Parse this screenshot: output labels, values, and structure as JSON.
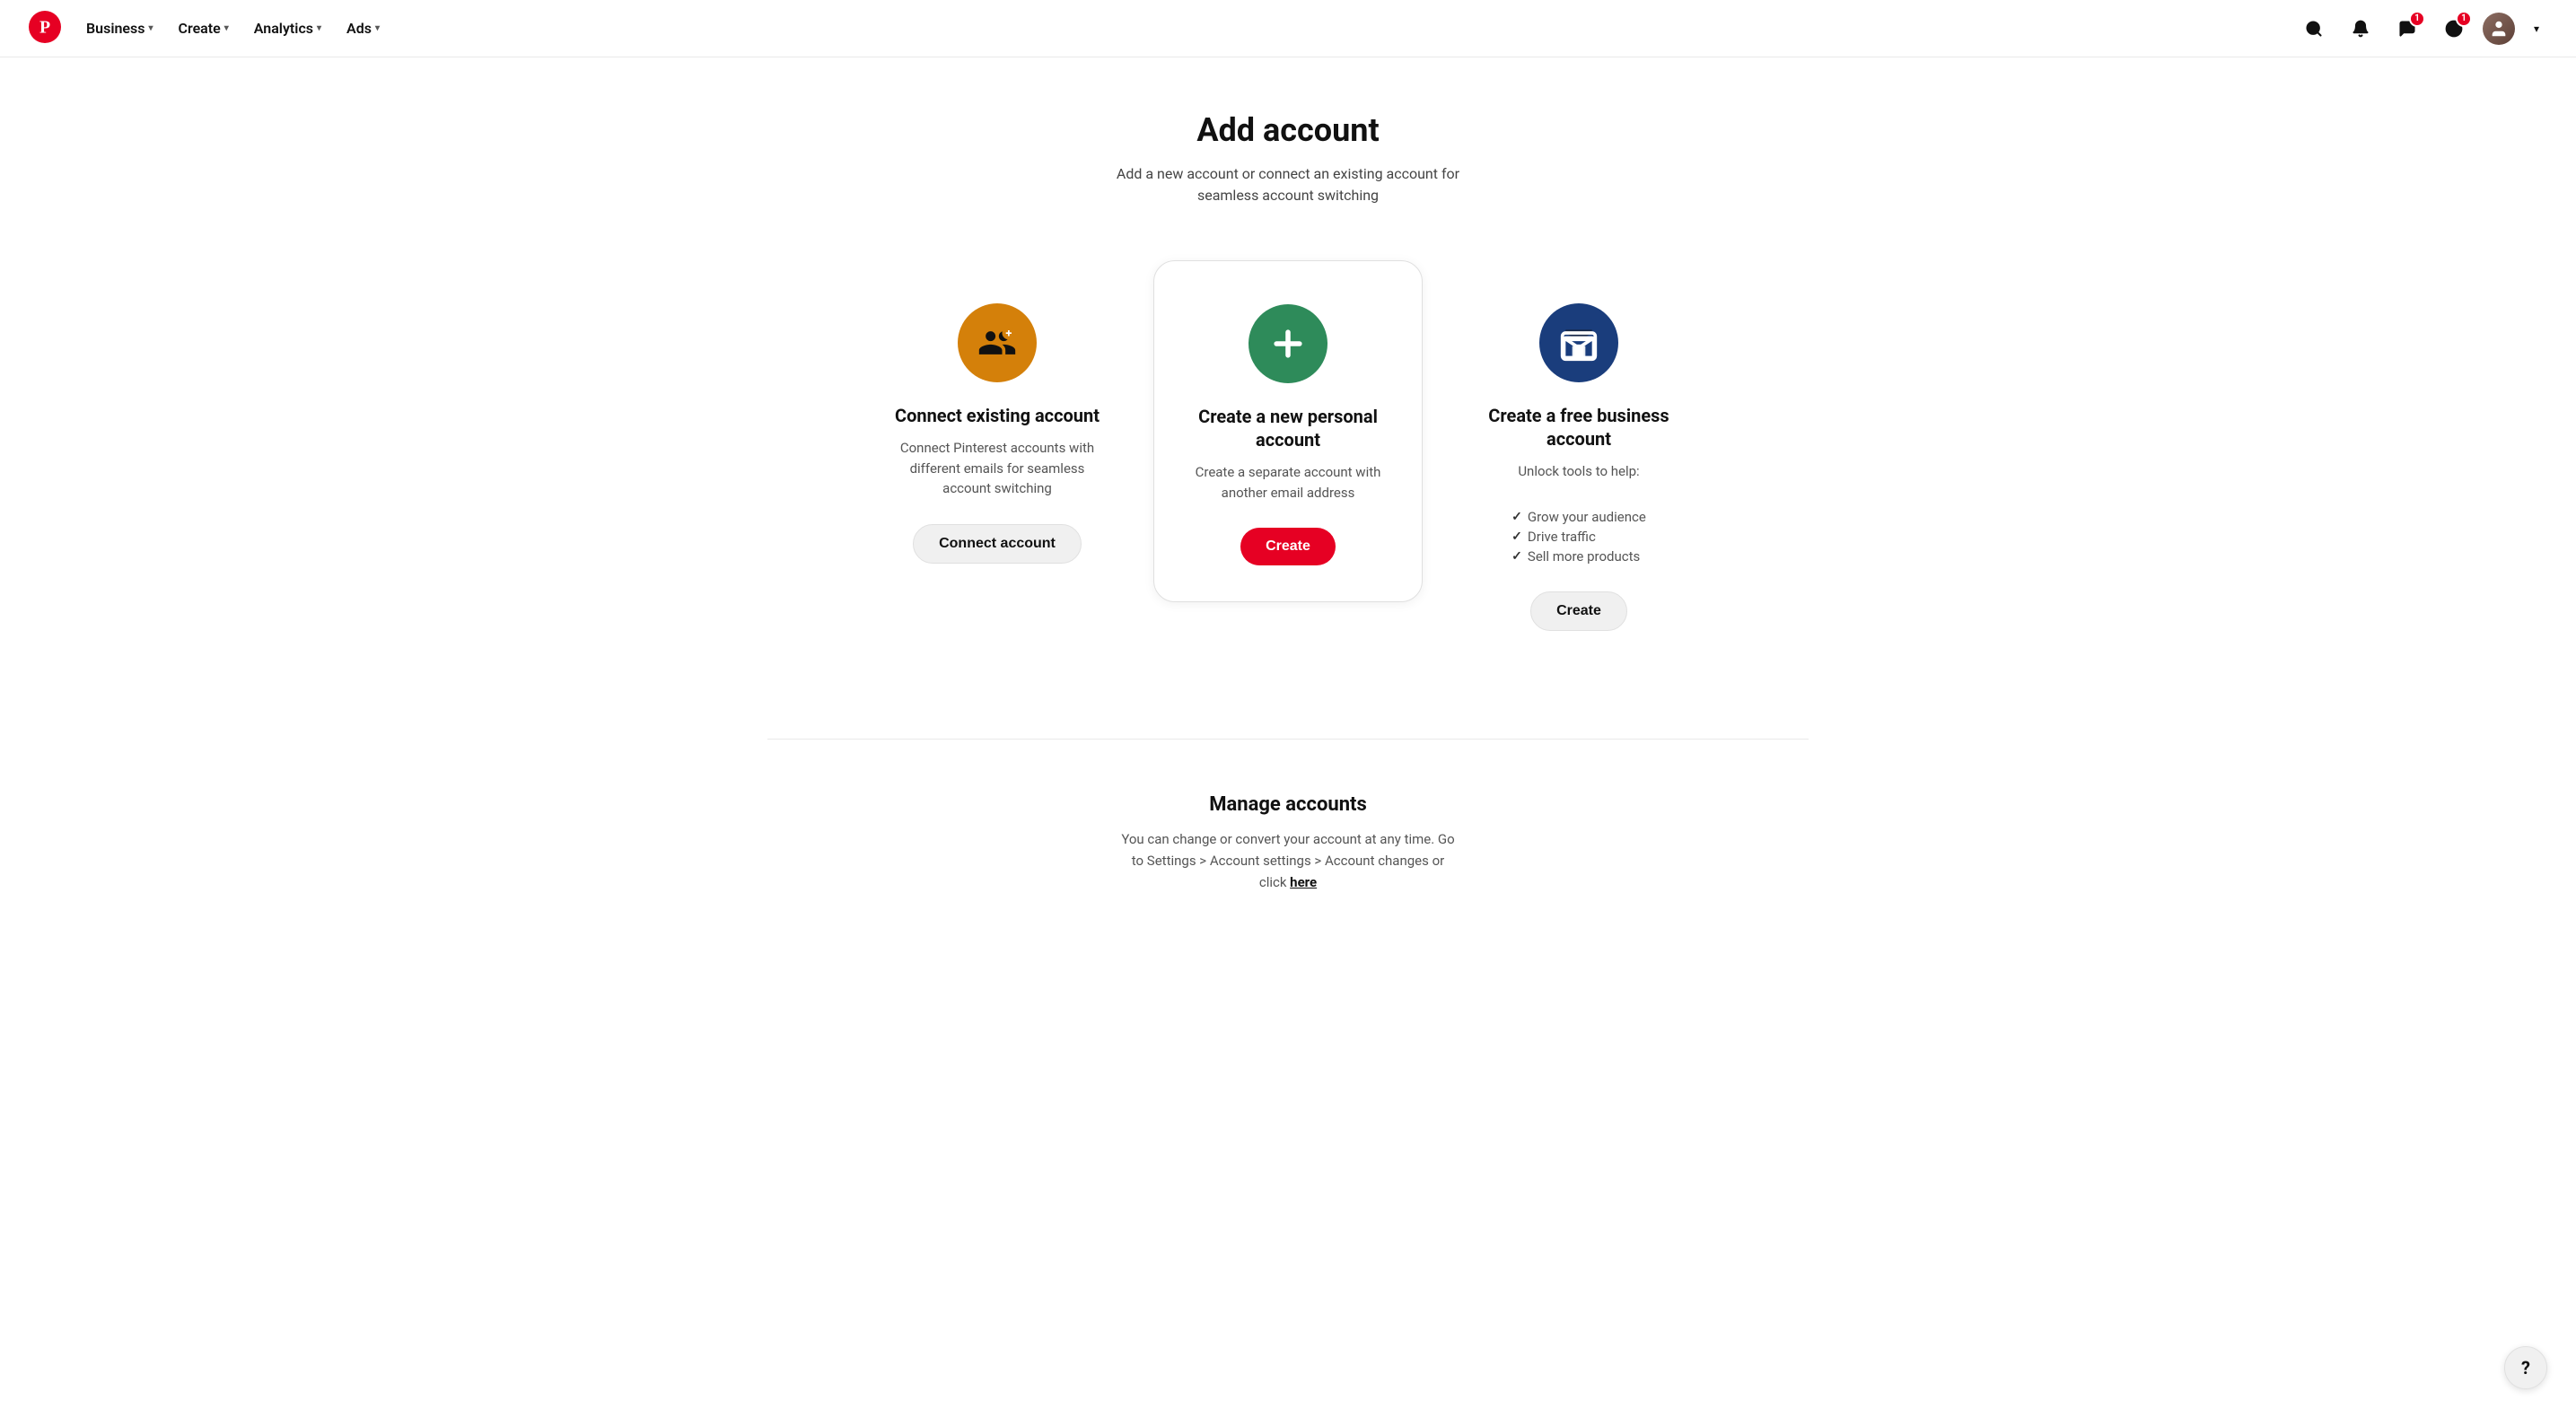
{
  "nav": {
    "logo_alt": "Pinterest",
    "items": [
      {
        "label": "Business",
        "id": "business"
      },
      {
        "label": "Create",
        "id": "create"
      },
      {
        "label": "Analytics",
        "id": "analytics"
      },
      {
        "label": "Ads",
        "id": "ads"
      }
    ],
    "search_tooltip": "Search",
    "notifications_tooltip": "Notifications",
    "messages_tooltip": "Messages",
    "messages_badge": "1",
    "notifications_badge": "1",
    "profile_tooltip": "Profile"
  },
  "page": {
    "title": "Add account",
    "subtitle": "Add a new account or connect an existing account for\nseamless account switching"
  },
  "cards": [
    {
      "id": "connect",
      "icon_color": "#d4800a",
      "icon_type": "person-add",
      "title": "Connect existing account",
      "description": "Connect Pinterest accounts with different emails for seamless account switching",
      "button_label": "Connect account",
      "button_style": "outline",
      "checklist": []
    },
    {
      "id": "new-personal",
      "icon_color": "#2e8b5a",
      "icon_type": "plus",
      "title": "Create a new personal account",
      "description": "Create a separate account with another email address",
      "button_label": "Create",
      "button_style": "primary",
      "featured": true,
      "checklist": []
    },
    {
      "id": "business",
      "icon_color": "#1a3d7c",
      "icon_type": "store",
      "title": "Create a free business account",
      "description": "Unlock tools to help:",
      "button_label": "Create",
      "button_style": "outline",
      "checklist": [
        "Grow your audience",
        "Drive traffic",
        "Sell more products"
      ]
    }
  ],
  "manage": {
    "title": "Manage accounts",
    "description": "You can change or convert your account at any time. Go to Settings > Account settings > Account changes or click",
    "link_text": "here"
  },
  "help": {
    "label": "?"
  }
}
